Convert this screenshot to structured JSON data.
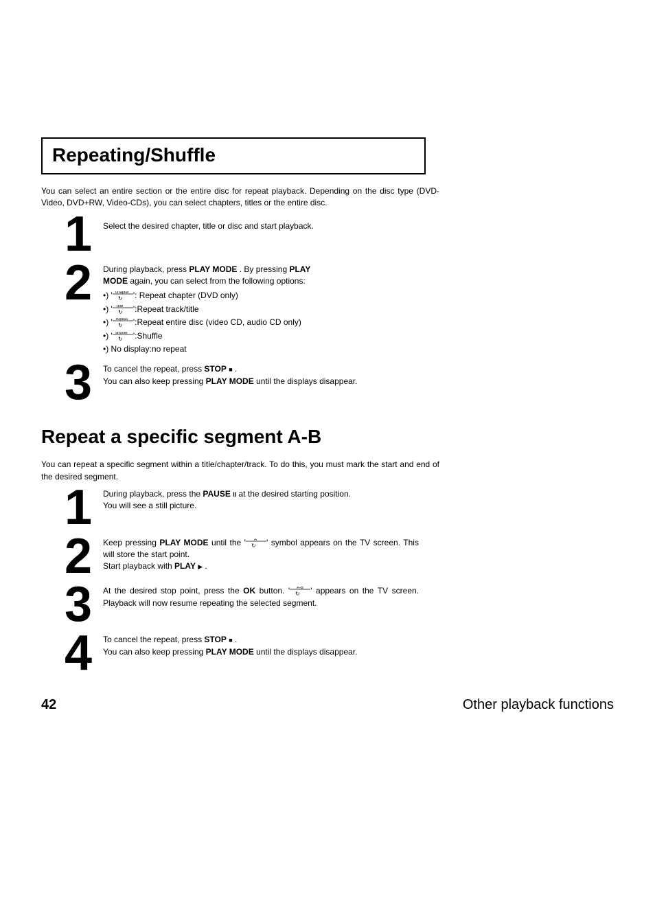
{
  "headings": {
    "repeating_shuffle": "Repeating/Shuffle",
    "repeat_ab": "Repeat a specific segment A-B"
  },
  "section1": {
    "intro": "You can select an entire section or the entire disc for repeat playback. Depending on the disc type (DVD-Video, DVD+RW, Video-CDs), you can select chapters, titles or the entire disc.",
    "step1": {
      "num": "1",
      "text": "Select the desired chapter, title or disc and start playback."
    },
    "step2": {
      "num": "2",
      "lead1_a": "During playback, press ",
      "play_mode": "PLAY MODE",
      "lead1_b": " . By pressing ",
      "play": "PLAY",
      "lead2_a": "MODE",
      "lead2_b": " again, you can select from the following options:",
      "b1_pre": "•) '",
      "b1_label": "chapter",
      "b1_post": "': Repeat chapter (DVD only)",
      "b2_pre": "•) '",
      "b2_label": "title",
      "b2_post": "':Repeat track/title",
      "b3_pre": "•) '",
      "b3_label": "repeat",
      "b3_post": "':Repeat entire disc (video CD, audio CD only)",
      "b4_pre": "•) '",
      "b4_label": "shuffle",
      "b4_post": "':Shuffle",
      "b5": "•) No display:no repeat"
    },
    "step3": {
      "num": "3",
      "line1_a": "To cancel the repeat, press ",
      "stop": "STOP",
      "stop_sym": "■",
      "line1_b": " .",
      "line2_a": "You can also keep pressing ",
      "play_mode": "PLAY MODE",
      "line2_b": " until the displays disappear."
    }
  },
  "section2": {
    "intro": "You can repeat a specific segment within a title/chapter/track. To do this, you must mark the start and end of the desired segment.",
    "step1": {
      "num": "1",
      "line1_a": "During playback, press the ",
      "pause": "PAUSE",
      "pause_sym": "II",
      "line1_b": " at the desired starting position.",
      "line2": "You will see a still picture."
    },
    "step2": {
      "num": "2",
      "line1_a": "Keep pressing ",
      "play_mode": "PLAY MODE",
      "line1_b": " until the '",
      "sym_label": "A",
      "line1_c": "' symbol appears on the TV screen. This will store the start point.",
      "line2_a": "Start playback with ",
      "play": "PLAY",
      "play_sym": "▶",
      "line2_b": " ."
    },
    "step3": {
      "num": "3",
      "line1_a": "At the desired stop point, press the ",
      "ok": "OK",
      "line1_b": " button. '",
      "sym_label": "A-B",
      "line1_c": "' appears on the TV screen. Playback will now resume repeating the selected segment."
    },
    "step4": {
      "num": "4",
      "line1_a": "To cancel the repeat, press ",
      "stop": "STOP",
      "stop_sym": "■",
      "line1_b": " .",
      "line2_a": "You can also keep pressing ",
      "play_mode": "PLAY MODE",
      "line2_b": " until the displays disappear."
    }
  },
  "footer": {
    "page_num": "42",
    "title": "Other playback functions"
  }
}
